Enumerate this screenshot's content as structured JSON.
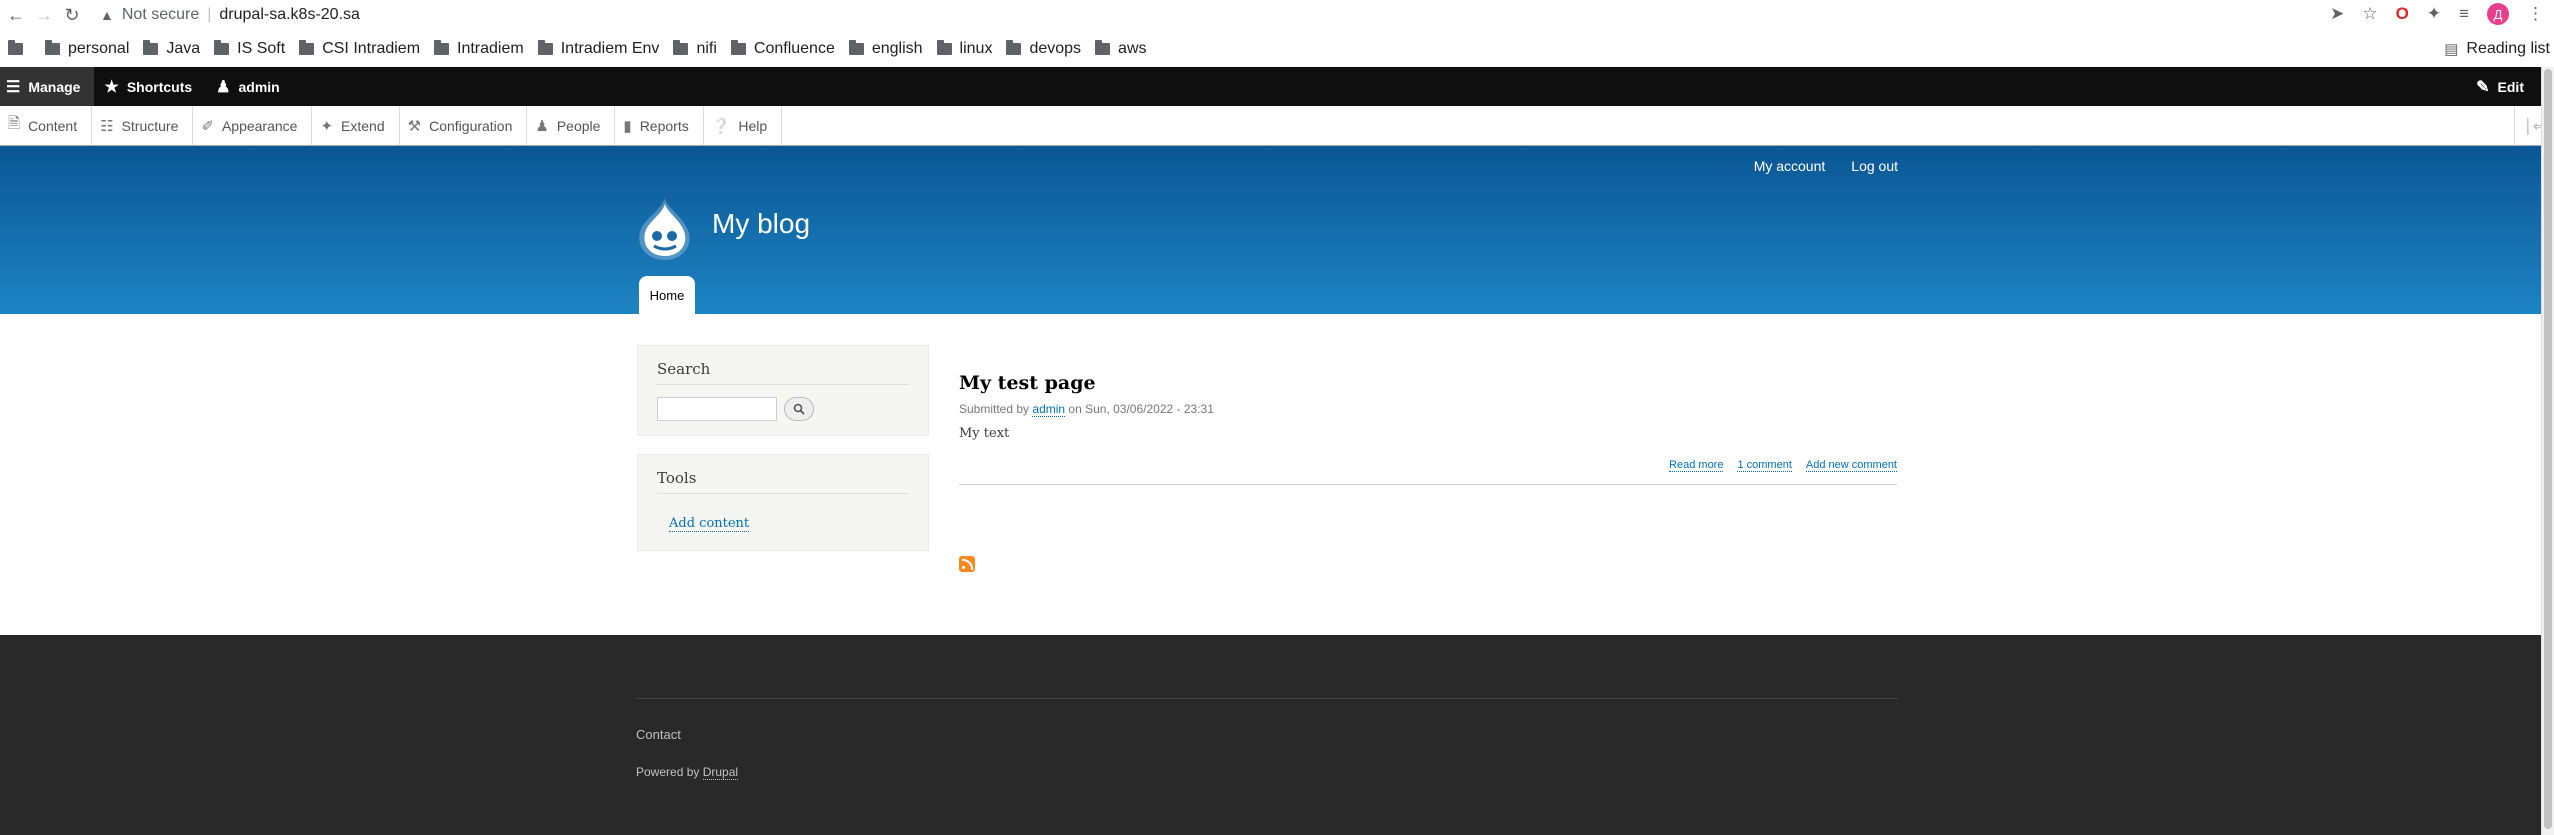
{
  "browser": {
    "security_label": "Not secure",
    "url": "drupal-sa.k8s-20.sa",
    "avatar_letter": "Д",
    "bookmarks": [
      "personal",
      "Java",
      "IS Soft",
      "CSI Intradiem",
      "Intradiem",
      "Intradiem Env",
      "nifi",
      "Confluence",
      "english",
      "linux",
      "devops",
      "aws"
    ],
    "reading_list": "Reading list"
  },
  "toolbar": {
    "manage": "Manage",
    "shortcuts": "Shortcuts",
    "user": "admin",
    "edit": "Edit",
    "tray": [
      "Content",
      "Structure",
      "Appearance",
      "Extend",
      "Configuration",
      "People",
      "Reports",
      "Help"
    ]
  },
  "header": {
    "my_account": "My account",
    "log_out": "Log out",
    "site_name": "My blog",
    "home_tab": "Home"
  },
  "sidebar": {
    "search_title": "Search",
    "tools_title": "Tools",
    "add_content": "Add content"
  },
  "node": {
    "title": "My test page",
    "submitted_prefix": "Submitted by",
    "author": "admin",
    "date": "on Sun, 03/06/2022 - 23:31",
    "body": "My text",
    "links": [
      "Read more",
      "1 comment",
      "Add new comment"
    ]
  },
  "footer": {
    "contact": "Contact",
    "powered_prefix": "Powered by",
    "drupal": "Drupal"
  }
}
